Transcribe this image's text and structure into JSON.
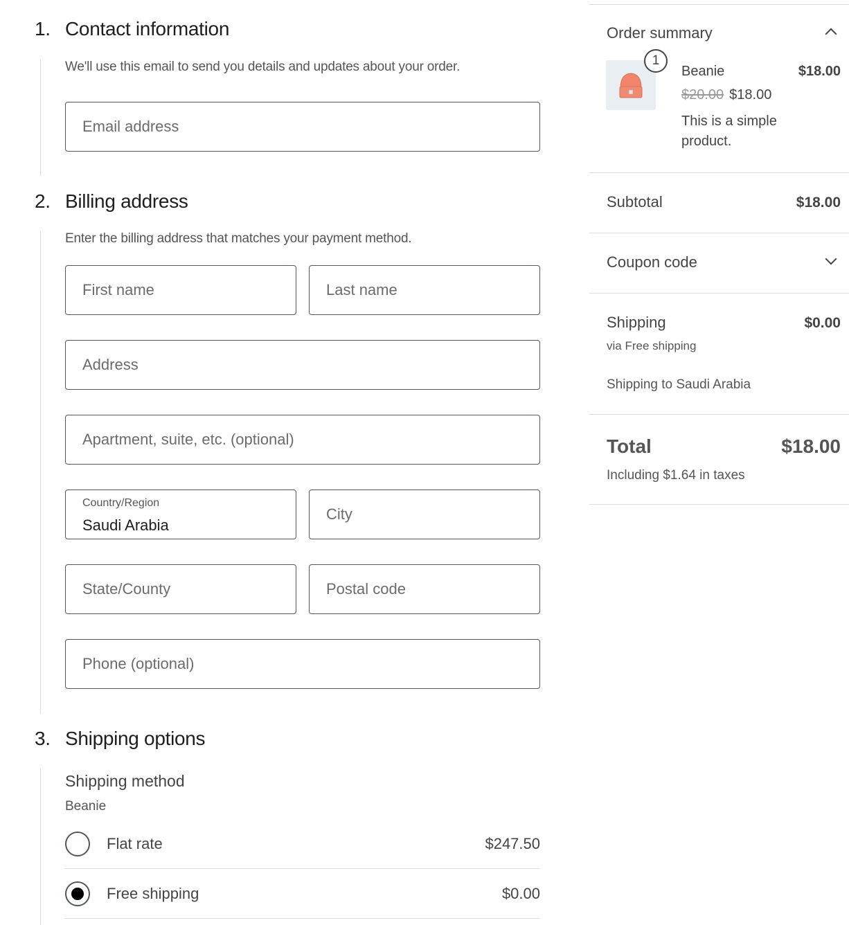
{
  "contact": {
    "number": "1.",
    "title": "Contact information",
    "description": "We'll use this email to send you details and updates about your order.",
    "email_placeholder": "Email address"
  },
  "billing": {
    "number": "2.",
    "title": "Billing address",
    "description": "Enter the billing address that matches your payment method.",
    "first_name_placeholder": "First name",
    "last_name_placeholder": "Last name",
    "address_placeholder": "Address",
    "apartment_placeholder": "Apartment, suite, etc. (optional)",
    "country_label": "Country/Region",
    "country_value": "Saudi Arabia",
    "city_placeholder": "City",
    "state_placeholder": "State/County",
    "postal_placeholder": "Postal code",
    "phone_placeholder": "Phone (optional)"
  },
  "shipping_options": {
    "number": "3.",
    "title": "Shipping options",
    "method_title": "Shipping method",
    "package_name": "Beanie",
    "options": [
      {
        "label": "Flat rate",
        "price": "$247.50",
        "selected": false
      },
      {
        "label": "Free shipping",
        "price": "$0.00",
        "selected": true
      }
    ]
  },
  "summary": {
    "title": "Order summary",
    "item": {
      "quantity": "1",
      "name": "Beanie",
      "line_total": "$18.00",
      "regular_price": "$20.00",
      "sale_price": "$18.00",
      "description": "This is a simple product.",
      "image_icon": "beanie-image"
    },
    "subtotal_label": "Subtotal",
    "subtotal_value": "$18.00",
    "coupon_label": "Coupon code",
    "shipping_label": "Shipping",
    "shipping_value": "$0.00",
    "shipping_method": "via Free shipping",
    "shipping_destination": "Shipping to Saudi Arabia",
    "total_label": "Total",
    "total_value": "$18.00",
    "tax_note": "Including $1.64 in taxes"
  }
}
